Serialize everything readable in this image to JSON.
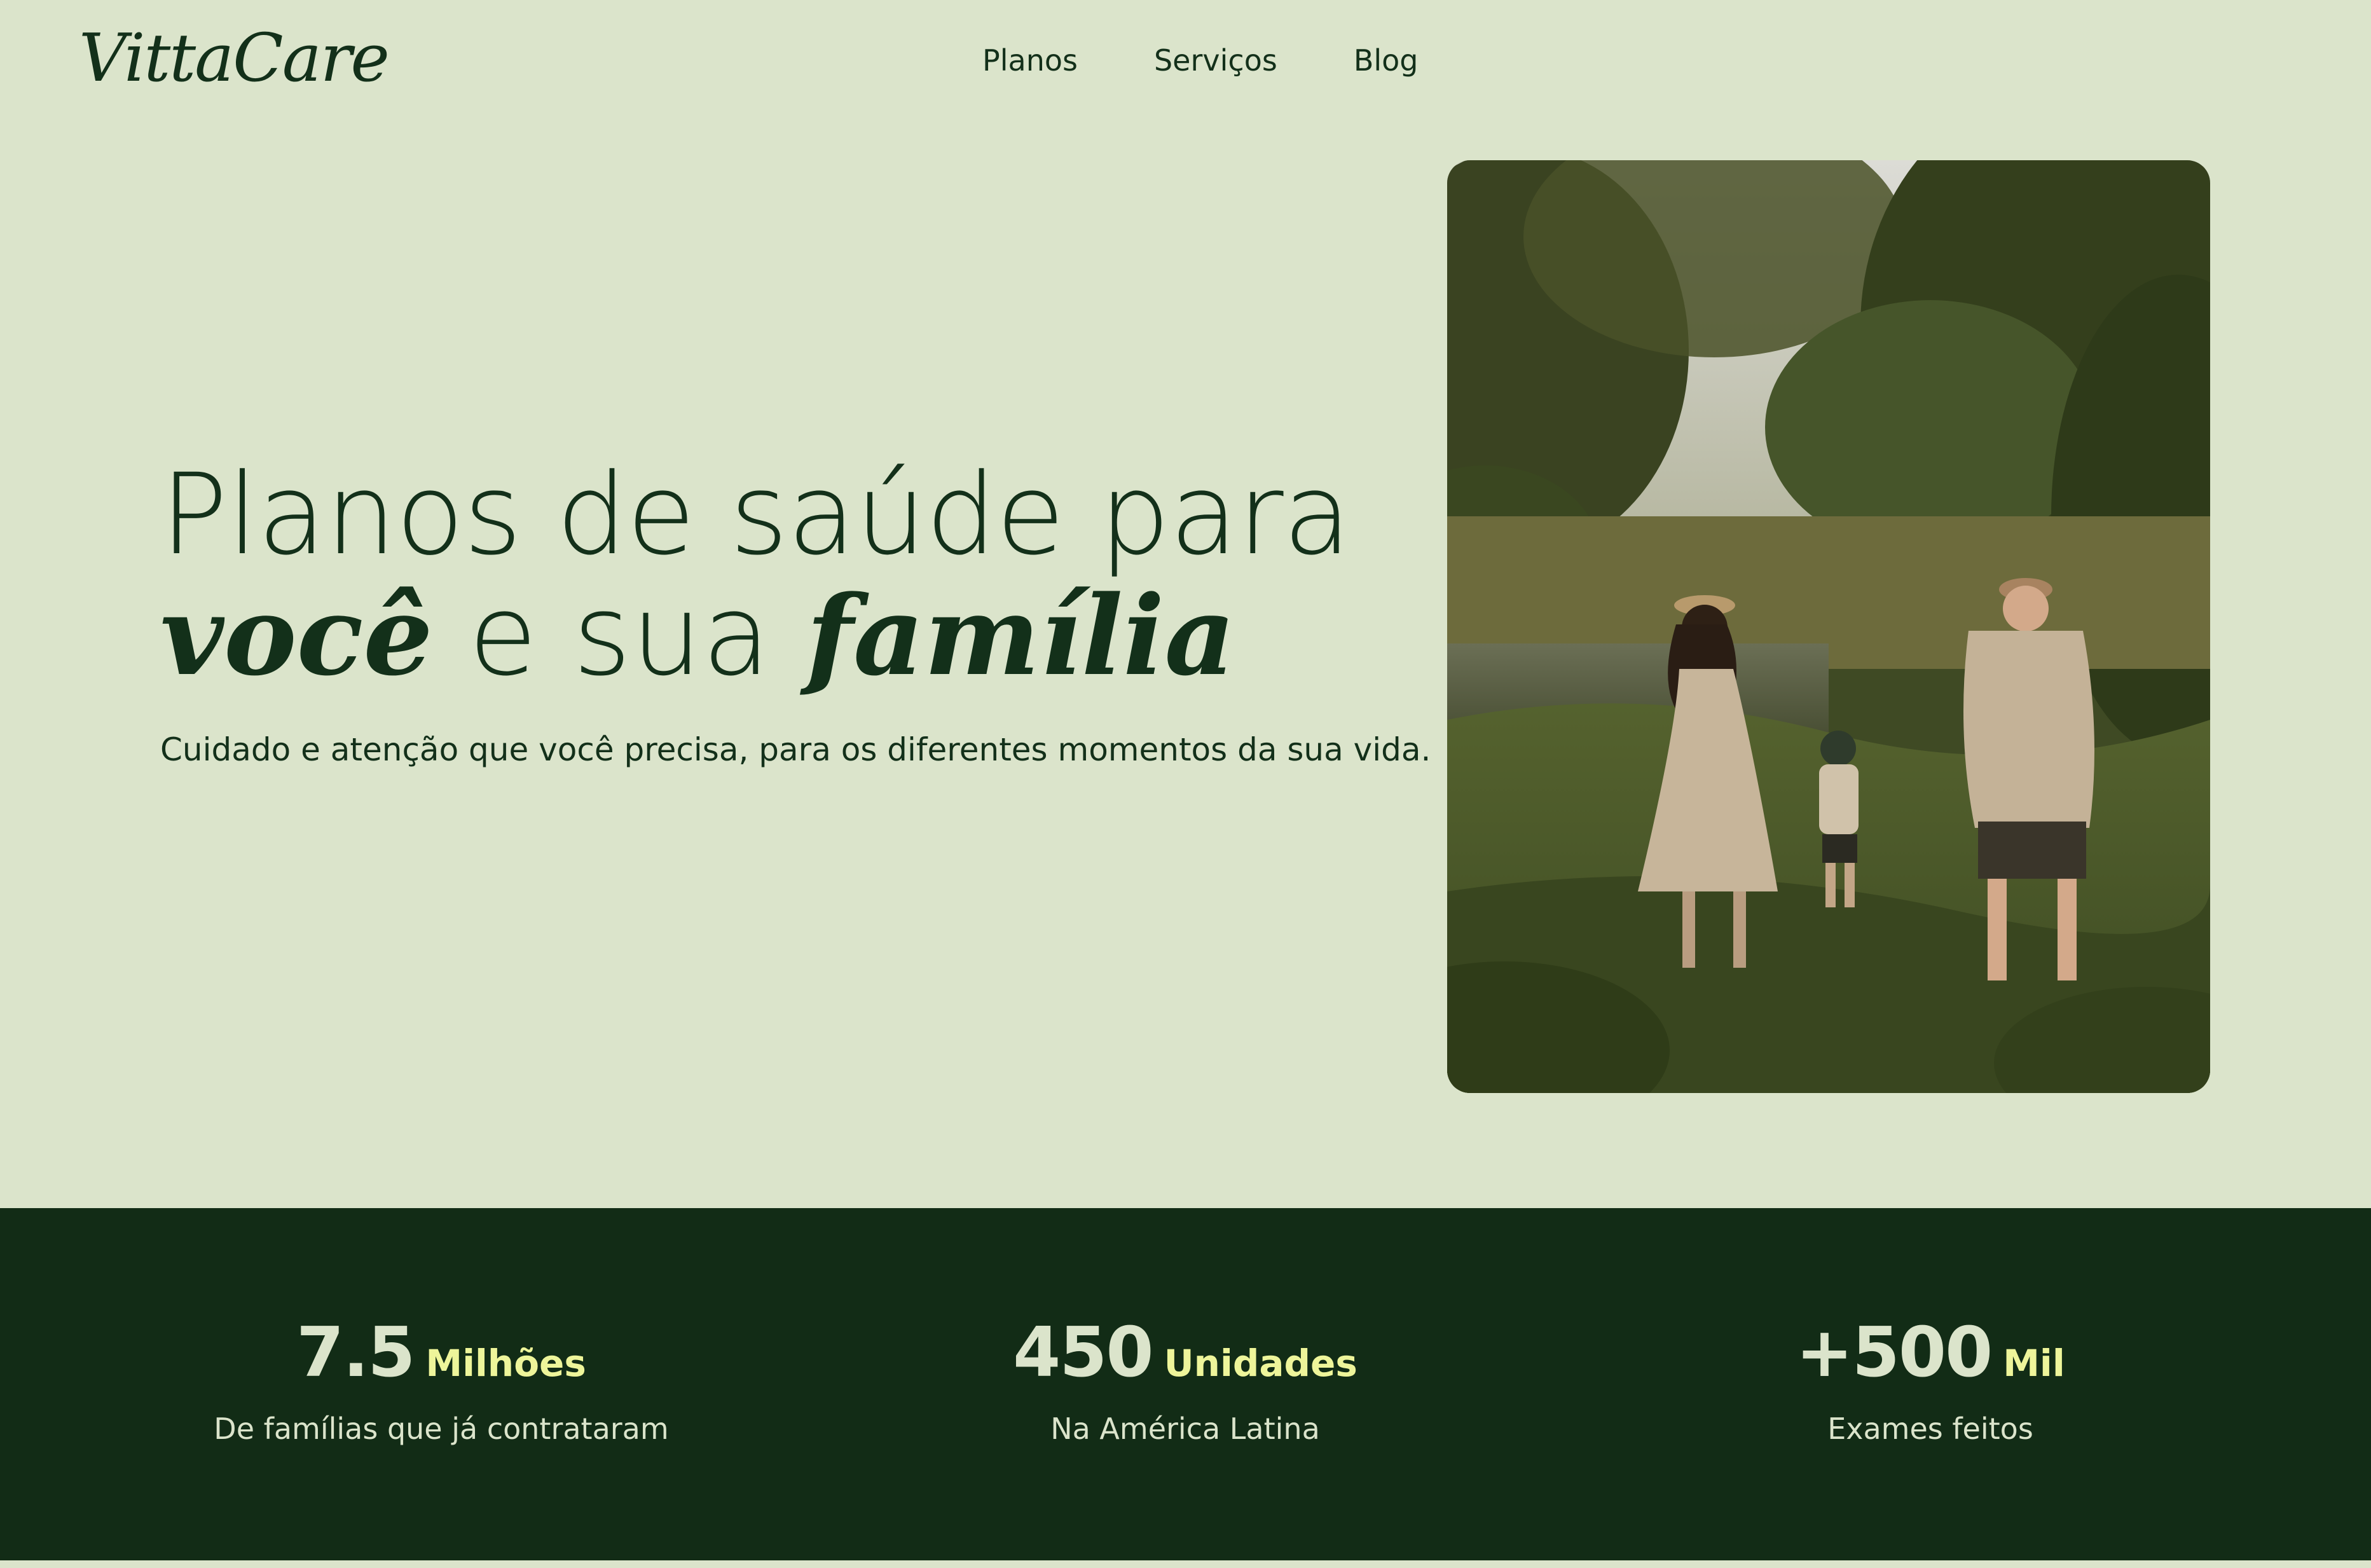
{
  "header": {
    "logo": "VittaCare",
    "nav": [
      "Planos",
      "Serviços",
      "Blog"
    ]
  },
  "hero": {
    "title_line1": "Planos de saúde para",
    "title_word1": "você",
    "title_mid": " e sua ",
    "title_word2": "família",
    "subtitle": "Cuidado e atenção que você precisa, para os diferentes momentos da sua vida.",
    "image_alt": "Família correndo de mãos dadas em um campo verde perto de um lago"
  },
  "stats": [
    {
      "number": "7.5",
      "unit": "Milhões",
      "description": "De famílias que já contrataram"
    },
    {
      "number": "450",
      "unit": "Unidades",
      "description": "Na América Latina"
    },
    {
      "number": "+500",
      "unit": "Mil",
      "description": "Exames feitos"
    }
  ],
  "colors": {
    "background": "#dbe4cb",
    "primary_dark": "#122c16",
    "text": "#13301a",
    "accent": "#eef59a"
  }
}
